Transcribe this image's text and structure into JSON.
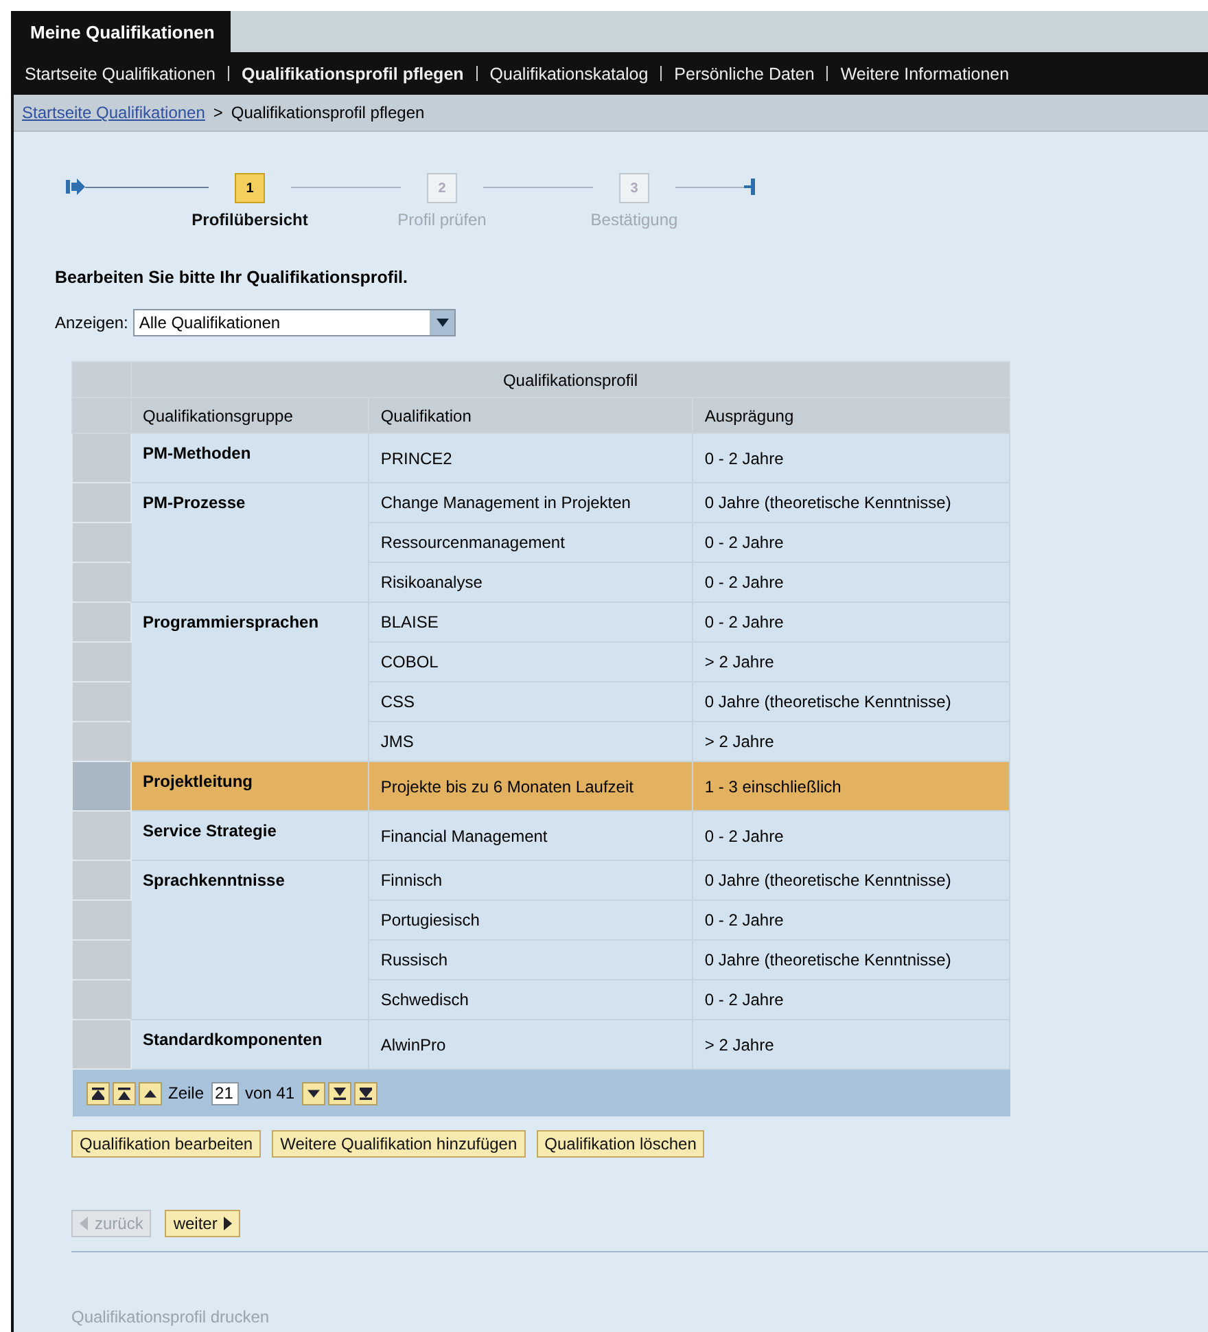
{
  "app_tab": {
    "label": "Meine Qualifikationen"
  },
  "nav": [
    {
      "label": "Startseite Qualifikationen",
      "selected": false
    },
    {
      "label": "Qualifikationsprofil pflegen",
      "selected": true
    },
    {
      "label": "Qualifikationskatalog",
      "selected": false
    },
    {
      "label": "Persönliche Daten",
      "selected": false
    },
    {
      "label": "Weitere Informationen",
      "selected": false
    }
  ],
  "breadcrumb": {
    "link": "Startseite Qualifikationen",
    "separator": ">",
    "current": "Qualifikationsprofil pflegen"
  },
  "steps": [
    {
      "number": "1",
      "label": "Profilübersicht",
      "selected": true
    },
    {
      "number": "2",
      "label": "Profil prüfen",
      "selected": false
    },
    {
      "number": "3",
      "label": "Bestätigung",
      "selected": false
    }
  ],
  "instruction": "Bearbeiten Sie bitte Ihr Qualifikationsprofil.",
  "filter": {
    "label": "Anzeigen:",
    "value": "Alle Qualifikationen"
  },
  "table": {
    "title": "Qualifikationsprofil",
    "columns": [
      "Qualifikationsgruppe",
      "Qualifikation",
      "Ausprägung"
    ],
    "groups": [
      {
        "name": "PM-Methoden",
        "rows": [
          {
            "qualification": "PRINCE2",
            "level_text": "0 - 2 Jahre",
            "selected": false
          }
        ]
      },
      {
        "name": "PM-Prozesse",
        "rows": [
          {
            "qualification": "Change Management in Projekten",
            "level_text": "0 Jahre (theoretische Kenntnisse)",
            "selected": false
          },
          {
            "qualification": "Ressourcenmanagement",
            "level_text": "0 - 2 Jahre",
            "selected": false
          },
          {
            "qualification": "Risikoanalyse",
            "level_text": "0 - 2 Jahre",
            "selected": false
          }
        ]
      },
      {
        "name": "Programmiersprachen",
        "rows": [
          {
            "qualification": "BLAISE",
            "level_text": "0 - 2 Jahre",
            "selected": false
          },
          {
            "qualification": "COBOL",
            "level_text": "> 2 Jahre",
            "selected": false
          },
          {
            "qualification": "CSS",
            "level_text": "0 Jahre (theoretische Kenntnisse)",
            "selected": false
          },
          {
            "qualification": "JMS",
            "level_text": "> 2 Jahre",
            "selected": false
          }
        ]
      },
      {
        "name": "Projektleitung",
        "rows": [
          {
            "qualification": "Projekte bis zu 6 Monaten Laufzeit",
            "level_text": "1 - 3 einschließlich",
            "selected": true
          }
        ]
      },
      {
        "name": "Service Strategie",
        "rows": [
          {
            "qualification": "Financial Management",
            "level_text": "0 - 2 Jahre",
            "selected": false
          }
        ]
      },
      {
        "name": "Sprachkenntnisse",
        "rows": [
          {
            "qualification": "Finnisch",
            "level_text": "0 Jahre (theoretische Kenntnisse)",
            "selected": false
          },
          {
            "qualification": "Portugiesisch",
            "level_text": "0 - 2 Jahre",
            "selected": false
          },
          {
            "qualification": "Russisch",
            "level_text": "0 Jahre (theoretische Kenntnisse)",
            "selected": false
          },
          {
            "qualification": "Schwedisch",
            "level_text": "0 - 2 Jahre",
            "selected": false
          }
        ]
      },
      {
        "name": "Standardkomponenten",
        "rows": [
          {
            "qualification": "AlwinPro",
            "level_text": "> 2 Jahre",
            "selected": false
          }
        ]
      }
    ],
    "pager": {
      "row_label": "Zeile",
      "row_value": "21",
      "of_label": "von 41"
    }
  },
  "actions": [
    "Qualifikation bearbeiten",
    "Weitere Qualifikation hinzufügen",
    "Qualifikation löschen"
  ],
  "back": {
    "label": "zurück",
    "disabled": true
  },
  "next": {
    "label": "weiter",
    "disabled": false
  },
  "print_link": "Qualifikationsprofil drucken"
}
